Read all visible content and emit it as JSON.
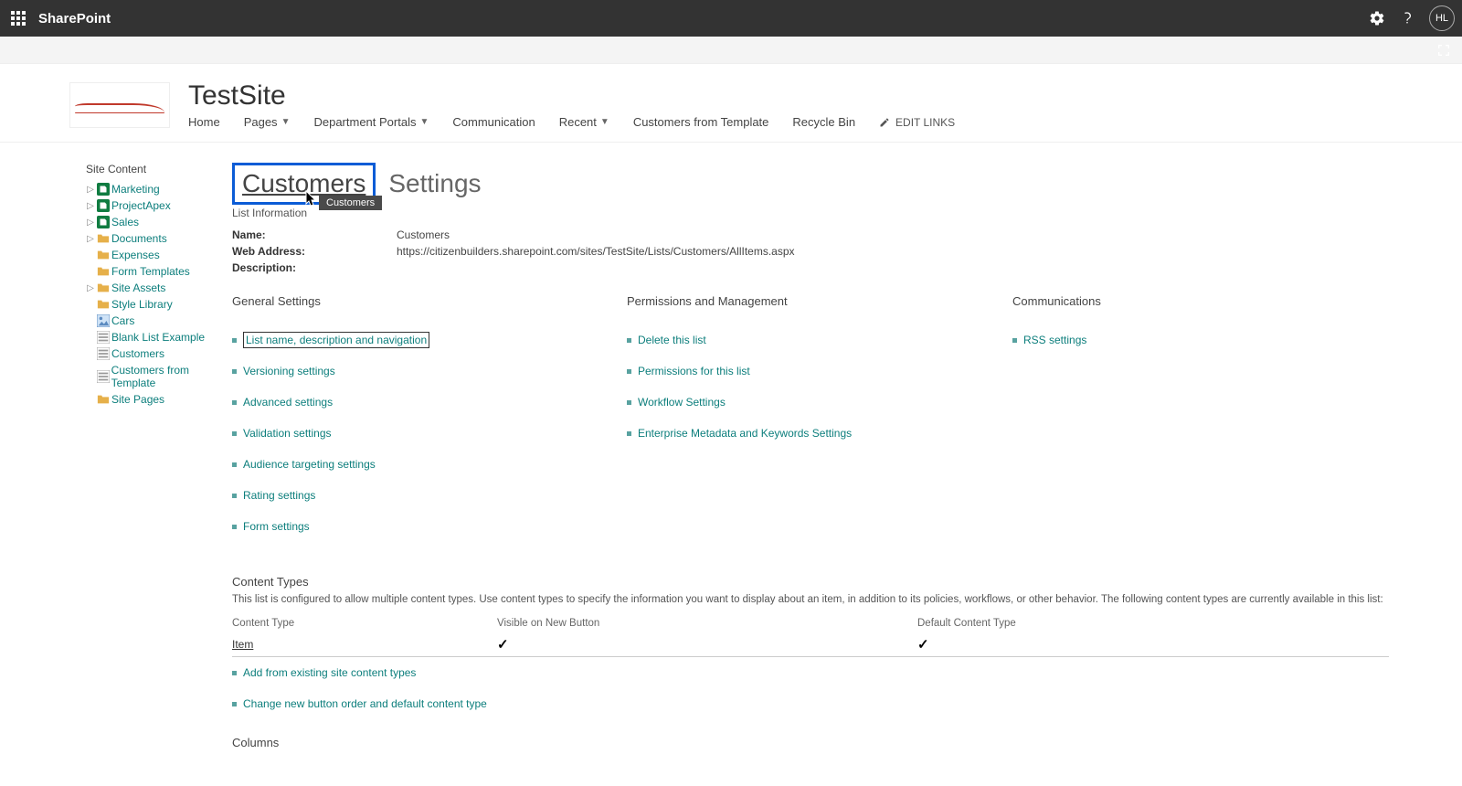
{
  "suiteBar": {
    "brand": "SharePoint",
    "avatar": "HL"
  },
  "header": {
    "siteTitle": "TestSite",
    "nav": {
      "home": "Home",
      "pages": "Pages",
      "deptPortals": "Department Portals",
      "communication": "Communication",
      "recent": "Recent",
      "custFromTpl": "Customers from Template",
      "recycle": "Recycle Bin",
      "editLinks": "EDIT LINKS"
    }
  },
  "leftNav": {
    "title": "Site Content",
    "items": {
      "marketing": "Marketing",
      "projectApex": "ProjectApex",
      "sales": "Sales",
      "documents": "Documents",
      "expenses": "Expenses",
      "formTemplates": "Form Templates",
      "siteAssets": "Site Assets",
      "styleLibrary": "Style Library",
      "cars": "Cars",
      "blankList": "Blank List Example",
      "customers": "Customers",
      "customersFromTpl": "Customers from Template",
      "sitePages": "Site Pages"
    }
  },
  "page": {
    "listLink": "Customers",
    "suffix": "Settings",
    "tooltip": "Customers",
    "listInfoHeader": "List Information",
    "info": {
      "nameLabel": "Name:",
      "nameVal": "Customers",
      "webLabel": "Web Address:",
      "webVal": "https://citizenbuilders.sharepoint.com/sites/TestSite/Lists/Customers/AllItems.aspx",
      "descLabel": "Description:"
    },
    "cols": {
      "general": {
        "heading": "General Settings",
        "links": {
          "l1": "List name, description and navigation",
          "l2": "Versioning settings",
          "l3": "Advanced settings",
          "l4": "Validation settings",
          "l5": "Audience targeting settings",
          "l6": "Rating settings",
          "l7": "Form settings"
        }
      },
      "perms": {
        "heading": "Permissions and Management",
        "links": {
          "l1": "Delete this list",
          "l2": "Permissions for this list",
          "l3": "Workflow Settings",
          "l4": "Enterprise Metadata and Keywords Settings"
        }
      },
      "comm": {
        "heading": "Communications",
        "links": {
          "l1": "RSS settings"
        }
      }
    },
    "contentTypes": {
      "title": "Content Types",
      "desc": "This list is configured to allow multiple content types. Use content types to specify the information you want to display about an item, in addition to its policies, workflows, or other behavior. The following content types are currently available in this list:",
      "th1": "Content Type",
      "th2": "Visible on New Button",
      "th3": "Default Content Type",
      "row1": {
        "name": "Item"
      },
      "links": {
        "l1": "Add from existing site content types",
        "l2": "Change new button order and default content type"
      }
    },
    "columns": {
      "title": "Columns"
    }
  }
}
